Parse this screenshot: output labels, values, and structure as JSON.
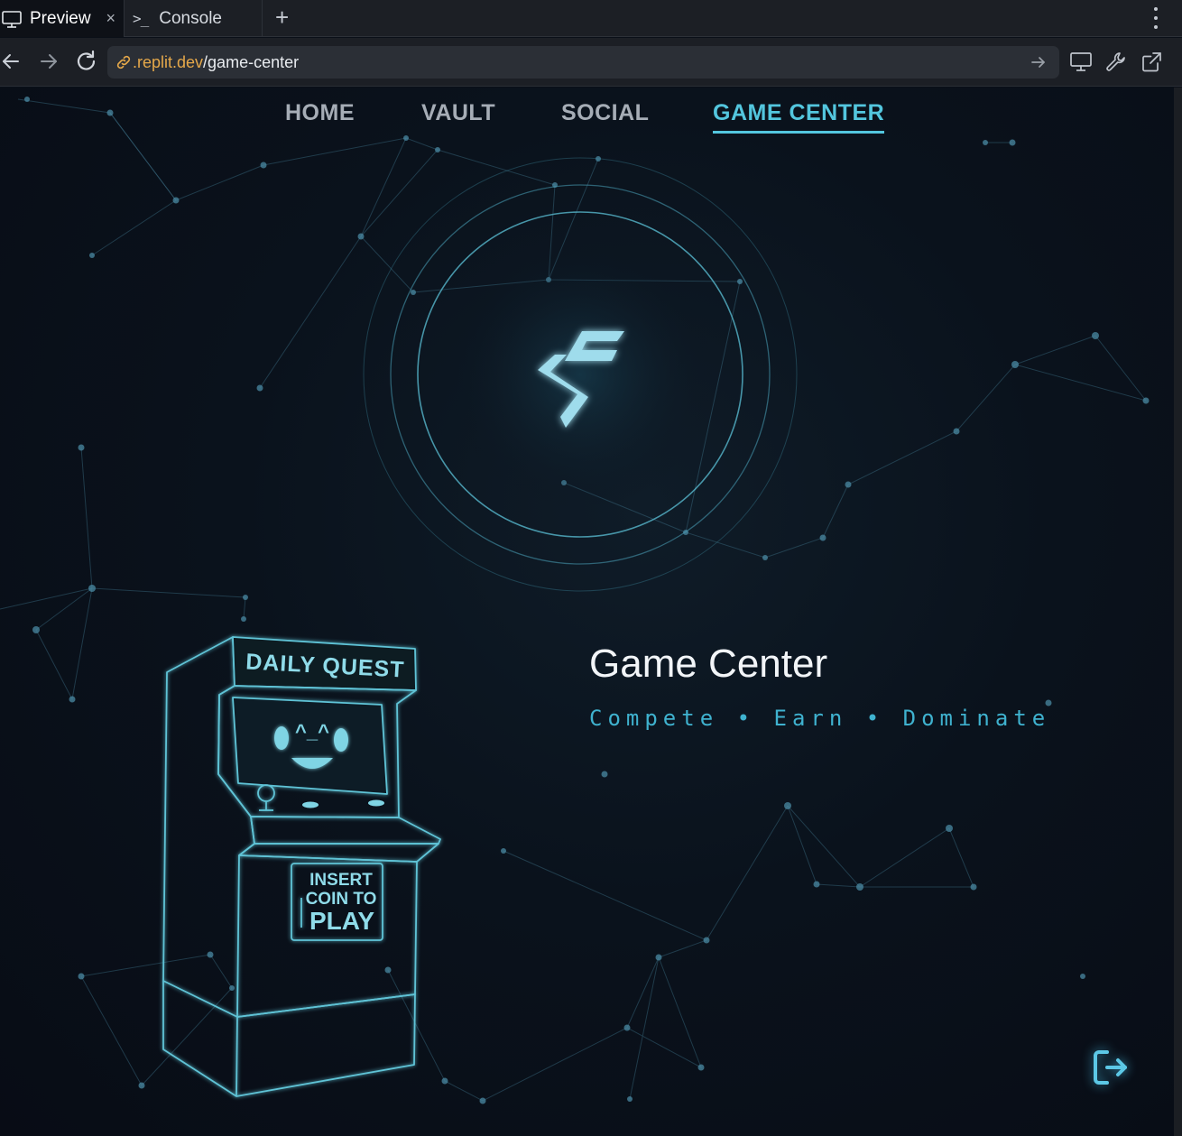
{
  "browser": {
    "tabs": [
      {
        "label": "Preview",
        "icon": "monitor-icon",
        "active": true,
        "close": "×"
      },
      {
        "label": "Console",
        "icon": "terminal-icon",
        "prompt": ">_",
        "active": false
      }
    ],
    "new_tab": "+",
    "url_host": ".replit.dev",
    "url_path": "/game-center"
  },
  "nav": {
    "items": [
      "HOME",
      "VAULT",
      "SOCIAL",
      "GAME CENTER"
    ],
    "active": "GAME CENTER"
  },
  "hero": {
    "title": "Game Center",
    "tagline": "Compete • Earn • Dominate"
  },
  "arcade": {
    "marquee": "DAILY QUEST",
    "face": "^_^",
    "coin_lines": [
      "INSERT",
      "COIN TO",
      "PLAY"
    ]
  },
  "icons": {
    "logout": "logout-icon",
    "emblem": "lightning-logo-icon"
  },
  "colors": {
    "accent": "#53c6de",
    "background": "#0a0f18",
    "url_host": "#e5a84a"
  }
}
